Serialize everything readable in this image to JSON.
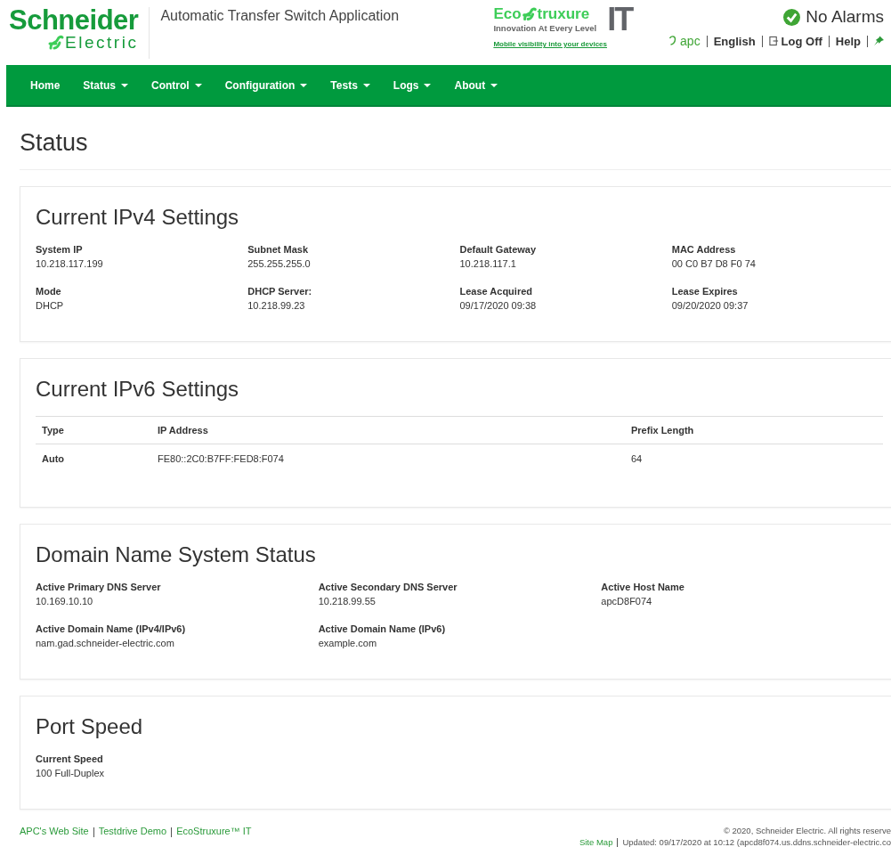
{
  "header": {
    "logo": {
      "top": "Schneider",
      "bottom": "Electric"
    },
    "app_title": "Automatic Transfer Switch Application",
    "ecostruxure": {
      "left": "Eco",
      "right": "truxure",
      "tagline": "Innovation At Every Level",
      "suffix": "IT",
      "link": "Mobile visibility into your devices"
    },
    "alarm_status": {
      "ok": true,
      "text": "No Alarms"
    },
    "user_links": [
      "apc",
      "English",
      "Log Off",
      "Help"
    ]
  },
  "nav": [
    {
      "label": "Home",
      "dropdown": false
    },
    {
      "label": "Status",
      "dropdown": true
    },
    {
      "label": "Control",
      "dropdown": true
    },
    {
      "label": "Configuration",
      "dropdown": true
    },
    {
      "label": "Tests",
      "dropdown": true
    },
    {
      "label": "Logs",
      "dropdown": true
    },
    {
      "label": "About",
      "dropdown": true
    }
  ],
  "page_title": "Status",
  "sections": [
    {
      "kind": "fields",
      "title": "Current IPv4 Settings",
      "fields": [
        {
          "label": "System IP",
          "value": "10.218.117.199"
        },
        {
          "label": "Subnet Mask",
          "value": "255.255.255.0"
        },
        {
          "label": "Default Gateway",
          "value": "10.218.117.1"
        },
        {
          "label": "MAC Address",
          "value": "00 C0 B7 D8 F0 74"
        },
        {
          "label": "Mode",
          "value": "DHCP"
        },
        {
          "label": "DHCP Server:",
          "value": "10.218.99.23"
        },
        {
          "label": "Lease Acquired",
          "value": "09/17/2020 09:38"
        },
        {
          "label": "Lease Expires",
          "value": "09/20/2020 09:37"
        }
      ]
    },
    {
      "kind": "table",
      "title": "Current IPv6 Settings",
      "columns": [
        "Type",
        "IP Address",
        "Prefix Length"
      ],
      "rows": [
        [
          "Auto",
          "FE80::2C0:B7FF:FED8:F074",
          "64"
        ]
      ]
    },
    {
      "kind": "trio",
      "title": "Domain Name System Status",
      "fields": [
        {
          "label": "Active Primary DNS Server",
          "value": "10.169.10.10"
        },
        {
          "label": "Active Secondary DNS Server",
          "value": "10.218.99.55"
        },
        {
          "label": "Active Host Name",
          "value": "apcD8F074"
        },
        {
          "label": "Active Domain Name (IPv4/IPv6)",
          "value": "nam.gad.schneider-electric.com"
        },
        {
          "label": "Active Domain Name (IPv6)",
          "value": "example.com"
        }
      ]
    },
    {
      "kind": "fields",
      "title": "Port Speed",
      "fields": [
        {
          "label": "Current Speed",
          "value": "100 Full-Duplex"
        }
      ]
    }
  ],
  "footer": {
    "links": [
      "APC's Web Site",
      "Testdrive Demo",
      "EcoStruxure™ IT"
    ],
    "copyright": "© 2020, Schneider Electric. All rights reserve",
    "site_map": "Site Map",
    "updated": "Updated: 09/17/2020 at 10:12 (apcd8f074.us.ddns.schneider-electric.co"
  }
}
